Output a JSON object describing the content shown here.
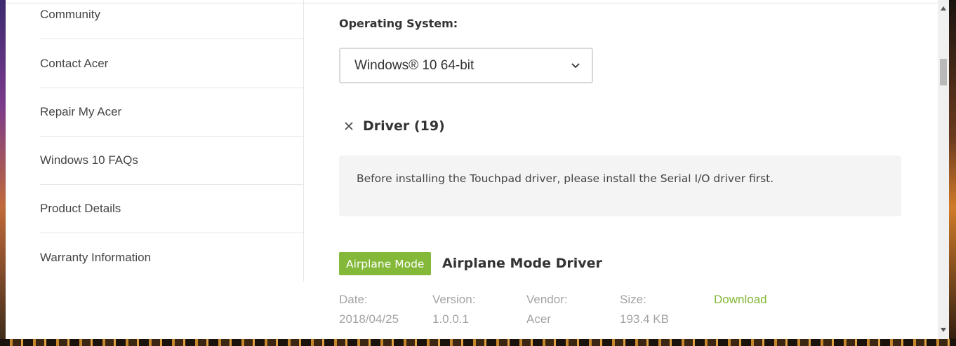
{
  "sidebar": {
    "items": [
      {
        "label": "Community"
      },
      {
        "label": "Contact Acer"
      },
      {
        "label": "Repair My Acer"
      },
      {
        "label": "Windows 10 FAQs"
      },
      {
        "label": "Product Details"
      },
      {
        "label": "Warranty Information"
      }
    ]
  },
  "main": {
    "os_label": "Operating System:",
    "os_selected": "Windows® 10 64-bit",
    "driver_section": {
      "title": "Driver (19)"
    },
    "notice": "Before installing the Touchpad driver, please install the Serial I/O driver first.",
    "driver": {
      "badge": "Airplane Mode",
      "name": "Airplane Mode Driver",
      "date_label": "Date:",
      "date": "2018/04/25",
      "version_label": "Version:",
      "version": "1.0.0.1",
      "vendor_label": "Vendor:",
      "vendor": "Acer",
      "size_label": "Size:",
      "size": "193.4 KB",
      "download_label": "Download"
    }
  },
  "colors": {
    "accent_green": "#83b838",
    "text_dark": "#333333",
    "text_muted": "#a3a3a3"
  }
}
